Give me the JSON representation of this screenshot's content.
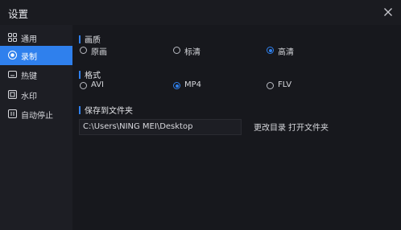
{
  "window": {
    "title": "设置"
  },
  "sidebar": {
    "items": [
      {
        "label": "通用",
        "icon": "grid-icon",
        "active": false
      },
      {
        "label": "录制",
        "icon": "record-icon",
        "active": true
      },
      {
        "label": "热键",
        "icon": "keyboard-icon",
        "active": false
      },
      {
        "label": "水印",
        "icon": "watermark-icon",
        "active": false
      },
      {
        "label": "自动停止",
        "icon": "auto-stop-icon",
        "active": false
      }
    ]
  },
  "quality": {
    "title": "画质",
    "options": [
      "原画",
      "标清",
      "高清"
    ],
    "selected": "高清"
  },
  "format": {
    "title": "格式",
    "options": [
      "AVI",
      "MP4",
      "FLV"
    ],
    "selected": "MP4"
  },
  "save": {
    "title": "保存到文件夹",
    "path": "C:\\Users\\NING MEI\\Desktop",
    "change_dir_label": "更改目录",
    "open_folder_label": "打开文件夹"
  },
  "colors": {
    "accent": "#2f80ed",
    "background": "#17181d",
    "sidebar": "#1d1e24"
  }
}
